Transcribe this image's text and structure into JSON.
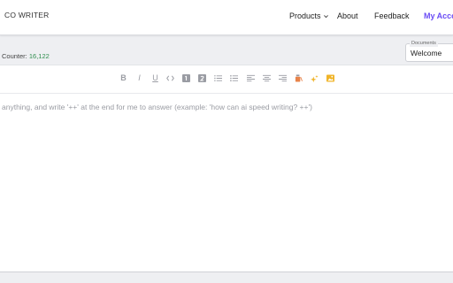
{
  "header": {
    "logo": "CO WRITER",
    "nav": {
      "products": "Products",
      "about": "About",
      "feedback": "Feedback",
      "account": "My Acco"
    }
  },
  "counter": {
    "label": "Counter:",
    "value": "16,122"
  },
  "documents": {
    "legend": "Documents",
    "selected": "Welcome"
  },
  "toolbar": {
    "bold": "B",
    "italic": "I",
    "underline": "U",
    "icons": [
      "code-icon",
      "heading-1-icon",
      "heading-2-icon",
      "bullet-list-icon",
      "ordered-list-icon",
      "align-left-icon",
      "align-center-icon",
      "align-right-icon",
      "clear-format-icon",
      "ai-sparkle-icon",
      "image-icon"
    ]
  },
  "editor": {
    "placeholder": "anything, and write '++' at the end for me to answer (example: 'how can ai speed writing? ++')"
  },
  "colors": {
    "accent": "#6a4cf5",
    "counter_value": "#2f8f4e",
    "toolbar_highlight": "#f0b429",
    "toolbar_icon": "#9a9ca3"
  }
}
